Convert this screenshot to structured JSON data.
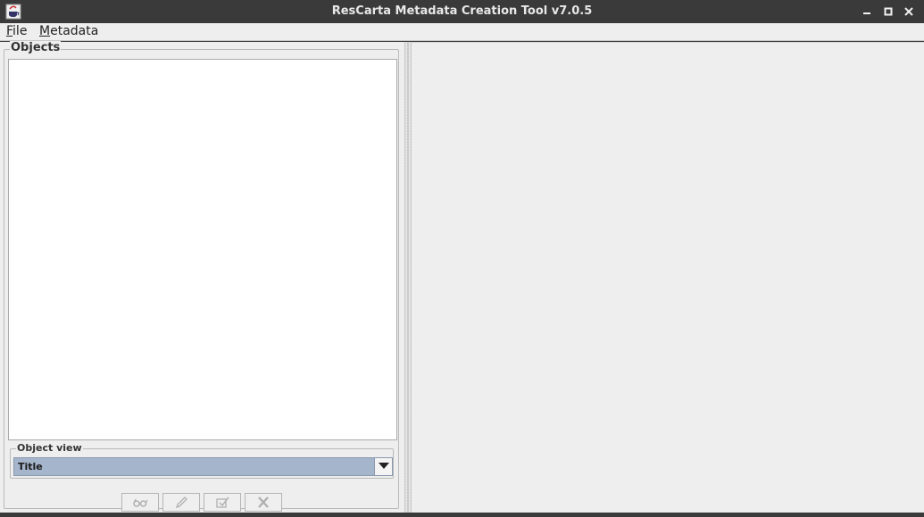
{
  "window": {
    "title": "ResCarta Metadata Creation Tool v7.0.5",
    "app_icon": "java-cup-icon",
    "controls": [
      "minimize-icon",
      "maximize-icon",
      "close-icon"
    ]
  },
  "menubar": {
    "file": {
      "mnemonic": "F",
      "rest": "ile"
    },
    "metadata": {
      "mnemonic": "M",
      "rest": "etadata"
    }
  },
  "objects_panel": {
    "title": "Objects",
    "items": []
  },
  "object_view": {
    "label": "Object view",
    "selected": "Title"
  },
  "toolbar": {
    "buttons": [
      {
        "icon": "glasses-icon",
        "enabled": false
      },
      {
        "icon": "pencil-icon",
        "enabled": false
      },
      {
        "icon": "edit-check-icon",
        "enabled": false
      },
      {
        "icon": "delete-x-icon",
        "enabled": false
      }
    ]
  },
  "colors": {
    "titlebar": "#3a3a3a",
    "panel": "#eeeeee",
    "selection": "#a5b5cc"
  }
}
